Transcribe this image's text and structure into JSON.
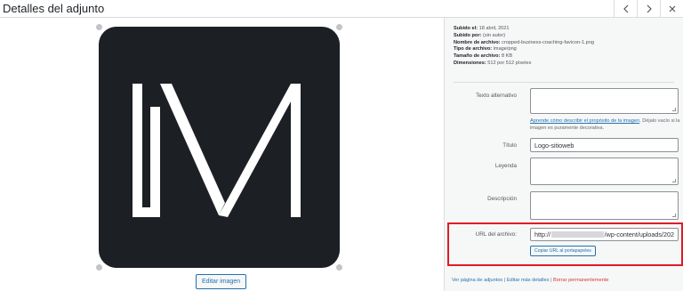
{
  "header": {
    "title": "Detalles del adjunto",
    "prev_icon": "chevron-left-icon",
    "next_icon": "chevron-right-icon",
    "close_icon": "close-icon"
  },
  "media": {
    "edit_button": "Editar imagen",
    "image_colors": {
      "background": "#1c1f24",
      "letters": "#ffffff"
    }
  },
  "meta": {
    "uploaded_on_label": "Subido el:",
    "uploaded_on": "18 abril, 2021",
    "uploaded_by_label": "Subido por:",
    "uploaded_by": "(sin autor)",
    "filename_label": "Nombre de archivo:",
    "filename": "cropped-business-coaching-favicon-1.png",
    "filetype_label": "Tipo de archivo:",
    "filetype": "image/png",
    "filesize_label": "Tamaño de archivo:",
    "filesize": "8 KB",
    "dimensions_label": "Dimensiones:",
    "dimensions": "512 por 512 píxeles"
  },
  "form": {
    "alt_label": "Texto alternativo",
    "alt_value": "",
    "help_link": "Aprende cómo describir el propósito de la imagen",
    "help_rest": ". Déjalo vacío si la imagen es puramente decorativa.",
    "title_label": "Título",
    "title_value": "Logo-sitioweb",
    "caption_label": "Leyenda",
    "caption_value": "",
    "description_label": "Descripción",
    "description_value": "",
    "url_label": "URL del archivo:",
    "url_prefix": "http://",
    "url_suffix": "/wp-content/uploads/202",
    "copy_button": "Copiar URL al portapapeles"
  },
  "footer_links": {
    "view": "Ver página de adjuntos",
    "separator": "|",
    "edit_more": "Editar más detalles",
    "delete": "Borrar permanentemente"
  },
  "colors": {
    "accent": "#2271b1",
    "danger": "#d63638",
    "highlight": "#e01b24"
  }
}
